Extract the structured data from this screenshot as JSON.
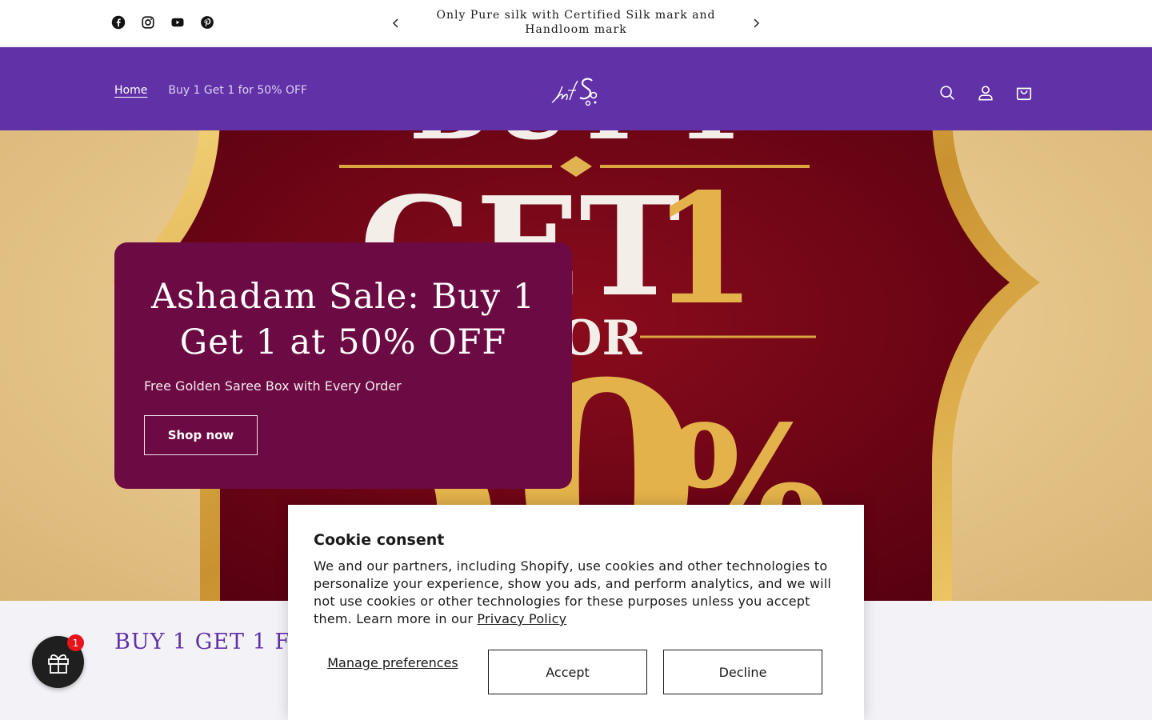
{
  "announcement": {
    "text": "Only Pure silk with Certified Silk mark and Handloom mark"
  },
  "social": [
    "facebook-icon",
    "instagram-icon",
    "youtube-icon",
    "pinterest-icon"
  ],
  "nav": {
    "items": [
      {
        "label": "Home"
      },
      {
        "label": "Buy 1 Get 1 for 50% OFF"
      }
    ]
  },
  "hero": {
    "title": "Ashadam Sale: Buy 1 Get 1 at 50% OFF",
    "subtitle": "Free Golden Saree Box with Every Order",
    "cta": "Shop now"
  },
  "section": {
    "heading": "BUY 1 GET 1 FOR"
  },
  "gift": {
    "badge": "1"
  },
  "cookie": {
    "title": "Cookie consent",
    "body": "We and our partners, including Shopify, use cookies and other technologies to personalize your experience, show you ads, and perform analytics, and we will not use cookies or other technologies for these purposes unless you accept them. Learn more in our ",
    "privacy_link": "Privacy Policy",
    "manage": "Manage preferences",
    "accept": "Accept",
    "decline": "Decline"
  },
  "colors": {
    "header": "#6131a8",
    "hero_card": "#6c0a43",
    "badge": "#e8141c"
  }
}
